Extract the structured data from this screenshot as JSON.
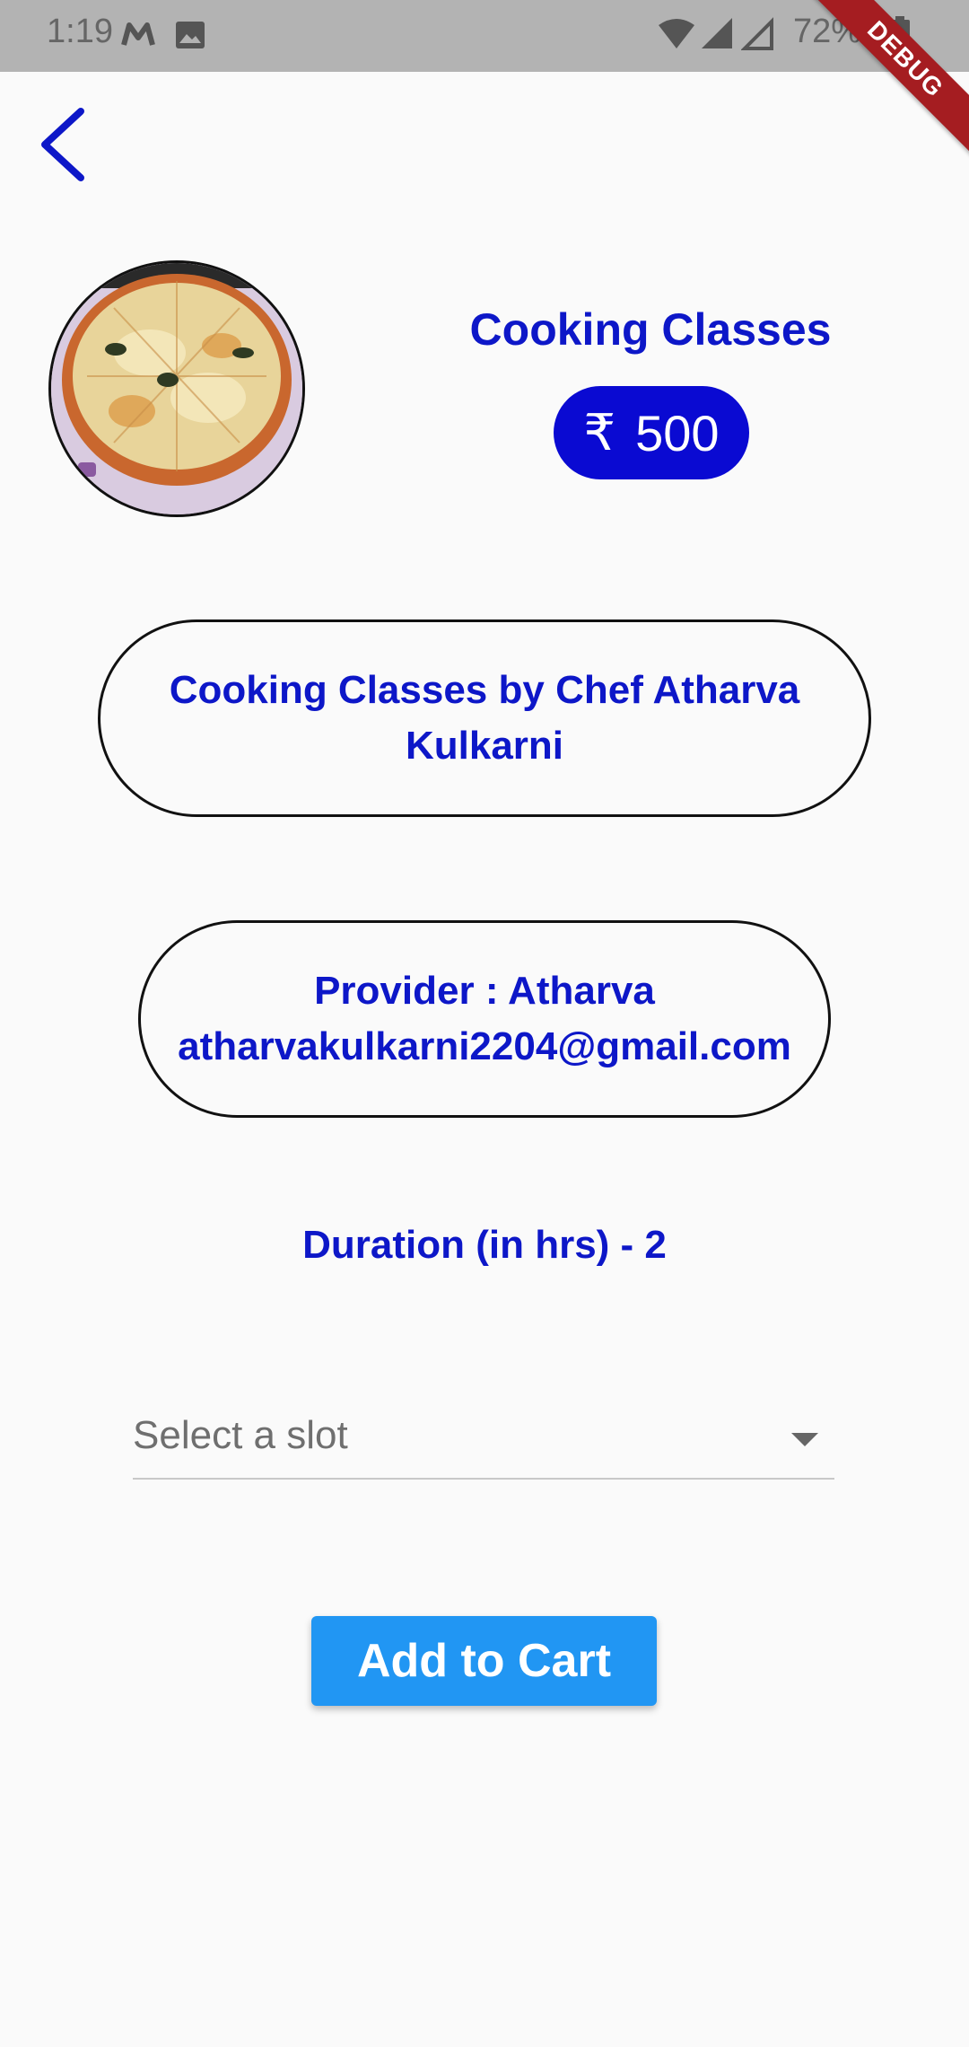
{
  "status_bar": {
    "time": "1:19",
    "battery_percent": "72%",
    "icons": [
      "m-app-icon",
      "image-icon",
      "wifi-icon",
      "signal-icon",
      "signal-icon-2",
      "battery-icon"
    ]
  },
  "debug_banner": "DEBUG",
  "product": {
    "title": "Cooking Classes",
    "currency_symbol": "₹",
    "price": "500",
    "description": "Cooking Classes by Chef Atharva Kulkarni",
    "provider_line": "Provider : Atharva",
    "provider_email": "atharvakulkarni2204@gmail.com",
    "duration_label": "Duration (in hrs) -  2"
  },
  "slot_select": {
    "placeholder": "Select a slot"
  },
  "actions": {
    "add_to_cart_label": "Add to Cart"
  },
  "colors": {
    "accent_text": "#0d17c8",
    "price_badge": "#0a0ad2",
    "button": "#2196f3",
    "status_bar": "#b3b3b3",
    "debug_ribbon": "#a51d21"
  }
}
